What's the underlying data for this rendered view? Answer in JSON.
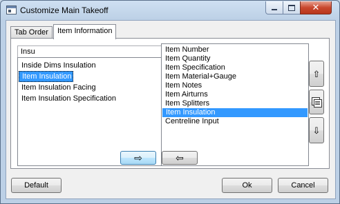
{
  "window": {
    "title": "Customize Main Takeoff",
    "close_glyph": "✕"
  },
  "tabs": [
    {
      "label": "Tab Order"
    },
    {
      "label": "Item Information"
    }
  ],
  "search": {
    "value": "Insu"
  },
  "left_list": {
    "items": [
      "Inside Dims Insulation",
      "Item Insulation",
      "Item Insulation Facing",
      "Item Insulation Specification"
    ],
    "selected": "Item Insulation"
  },
  "right_list": {
    "items": [
      "Item Number",
      "Item Quantity",
      "Item Specification",
      "Item Material+Gauge",
      "Item Notes",
      "Item Airturns",
      "Item Splitters",
      "Item Insulation",
      "Centreline Input"
    ],
    "selected": "Item Insulation"
  },
  "transfer": {
    "add_glyph": "⇨",
    "remove_glyph": "⇦"
  },
  "side": {
    "up_glyph": "⇧",
    "down_glyph": "⇩",
    "properties_icon": "properties-icon"
  },
  "footer": {
    "default_label": "Default",
    "ok_label": "Ok",
    "cancel_label": "Cancel"
  },
  "colors": {
    "selection": "#3399ff",
    "close_button": "#c9482e"
  }
}
